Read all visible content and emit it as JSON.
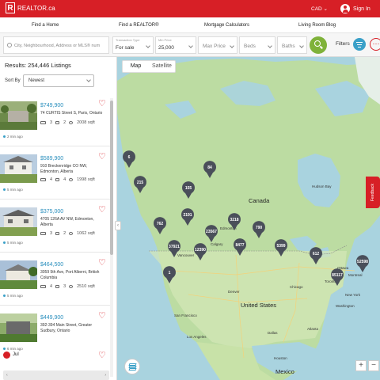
{
  "topbar": {
    "brand": "REALTOR.ca",
    "currency": "CAD",
    "signin": "Sign In"
  },
  "nav": {
    "items": [
      "Find a Home",
      "Find a REALTOR®",
      "Mortgage Calculators",
      "Living Room Blog"
    ]
  },
  "search": {
    "city_placeholder": "City, Neighbourhood, Address or MLS® num",
    "transaction_label": "Transaction Type",
    "transaction_value": "For sale",
    "min_price_label": "Min Price",
    "min_price_value": "25,000",
    "max_price_placeholder": "Max Price",
    "beds_placeholder": "Beds",
    "baths_placeholder": "Baths",
    "filters_label": "Filters"
  },
  "results": {
    "summary": "Results:  254,446 Listings",
    "sort_label": "Sort By",
    "sort_value": "Newest"
  },
  "listings": [
    {
      "price": "$749,900",
      "address": "74 CURTIS Street S, Paris, Ontario",
      "beds": "3",
      "baths": "2",
      "sqft": "2008 sqft",
      "time": "2 min ago"
    },
    {
      "price": "$589,900",
      "address": "910 Breckenridge CO NW, Edmonton, Alberta",
      "beds": "4",
      "baths": "4",
      "sqft": "1998 sqft",
      "time": "5 min ago"
    },
    {
      "price": "$375,000",
      "address": "4705 126A AV NW, Edmonton, Alberta",
      "beds": "3",
      "baths": "2",
      "sqft": "1062 sqft",
      "time": "5 min ago"
    },
    {
      "price": "$464,500",
      "address": "3059 5th Ave, Port Alberni, British Columbia",
      "beds": "4",
      "baths": "3",
      "sqft": "2510 sqft",
      "time": "5 min ago"
    },
    {
      "price": "$449,900",
      "address": "392-394 Main Street, Greater Sudbury, Ontario",
      "beds": "",
      "baths": "",
      "sqft": "",
      "time": "6 min ago"
    }
  ],
  "next_month": "Jul",
  "map": {
    "tabs": [
      "Map",
      "Satellite"
    ],
    "country_labels": [
      "Canada",
      "United States",
      "Mexico"
    ],
    "places": [
      "Hudson Bay",
      "Calgary",
      "Vancouver",
      "Edmonton",
      "Montreal",
      "Toronto",
      "Chicago",
      "New York",
      "Denver",
      "San Francisco",
      "Los Angeles",
      "Houston",
      "Dallas",
      "Atlanta",
      "Washington",
      "Ottawa"
    ],
    "clusters": [
      "6",
      "215",
      "84",
      "155",
      "2191",
      "3218",
      "762",
      "790",
      "23567",
      "37921",
      "12390",
      "8477",
      "5399",
      "612",
      "1",
      "85117",
      "52598"
    ],
    "feedback": "Feedback"
  }
}
